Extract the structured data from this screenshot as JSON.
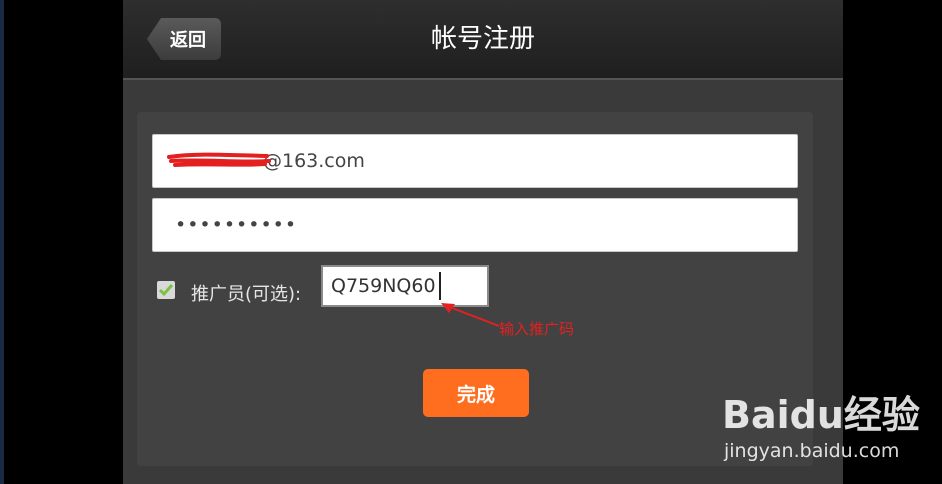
{
  "header": {
    "back_label": "返回",
    "title": "帐号注册"
  },
  "form": {
    "email_value": "@163.com",
    "password_value": "••••••••••",
    "promoter_label": "推广员(可选):",
    "promoter_value": "Q759NQ60",
    "promoter_checked": true,
    "submit_label": "完成"
  },
  "annotation": {
    "text": "输入推广码",
    "color": "#e52020"
  },
  "watermark": {
    "logo": "Baidu经验",
    "url": "jingyan.baidu.com"
  },
  "colors": {
    "accent": "#ff6d1f",
    "check": "#7cc241"
  }
}
